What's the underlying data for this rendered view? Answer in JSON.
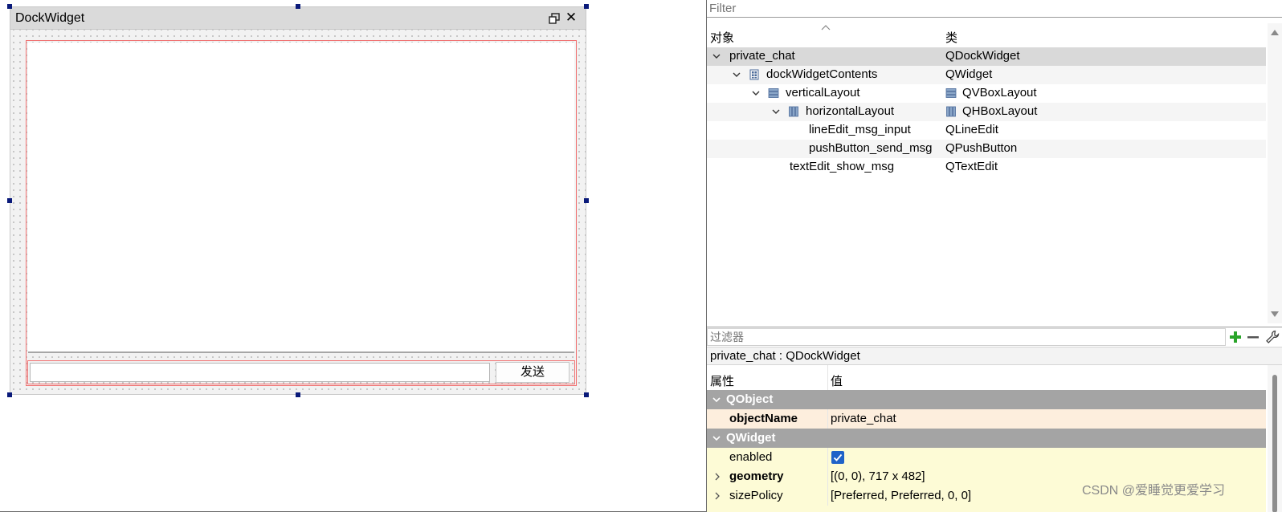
{
  "canvas": {
    "dock_title": "DockWidget",
    "send_button_label": "发送",
    "line_edit_value": ""
  },
  "object_inspector": {
    "filter_placeholder": "Filter",
    "columns": {
      "object": "对象",
      "class": "类"
    },
    "rows": [
      {
        "name": "private_chat",
        "class": "QDockWidget",
        "icon": "",
        "class_icon": ""
      },
      {
        "name": "dockWidgetContents",
        "class": "QWidget",
        "icon": "grid-layout-icon",
        "class_icon": ""
      },
      {
        "name": "verticalLayout",
        "class": "QVBoxLayout",
        "icon": "vertical-layout-icon",
        "class_icon": "vertical-layout-icon"
      },
      {
        "name": "horizontalLayout",
        "class": "QHBoxLayout",
        "icon": "horizontal-layout-icon",
        "class_icon": "horizontal-layout-icon"
      },
      {
        "name": "lineEdit_msg_input",
        "class": "QLineEdit",
        "icon": "",
        "class_icon": ""
      },
      {
        "name": "pushButton_send_msg",
        "class": "QPushButton",
        "icon": "",
        "class_icon": ""
      },
      {
        "name": "textEdit_show_msg",
        "class": "QTextEdit",
        "icon": "",
        "class_icon": ""
      }
    ]
  },
  "property_editor": {
    "filter_placeholder": "过滤器",
    "object_label": "private_chat : QDockWidget",
    "columns": {
      "property": "属性",
      "value": "值"
    },
    "groups": [
      {
        "name": "QObject",
        "rows": [
          {
            "name": "objectName",
            "value": "private_chat"
          }
        ]
      },
      {
        "name": "QWidget",
        "rows": [
          {
            "name": "enabled",
            "value": ""
          },
          {
            "name": "geometry",
            "value": "[(0, 0), 717 x 482]"
          },
          {
            "name": "sizePolicy",
            "value": "[Preferred, Preferred, 0, 0]"
          }
        ]
      }
    ],
    "enabled_checked": true
  },
  "watermark": "CSDN @爱睡觉更爱学习",
  "colors": {
    "accent_blue": "#1f62c8",
    "add_green": "#2aa52a",
    "layout_outline_red": "#f07070",
    "group_header_gray": "#a4a4a4",
    "qobject_row": "#fdeedd",
    "qwidget_row": "#fdfbd6"
  }
}
